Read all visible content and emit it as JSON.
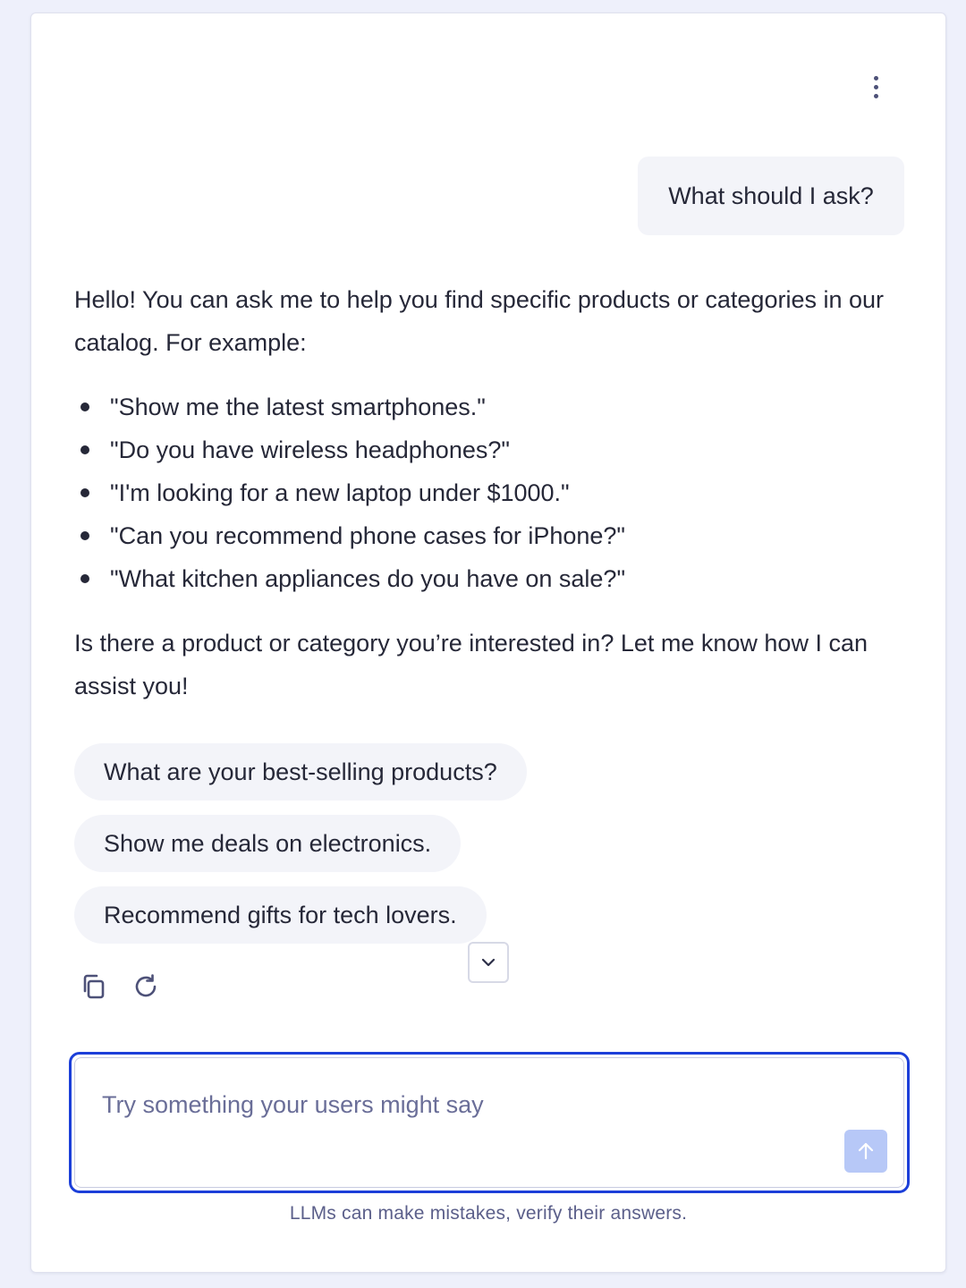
{
  "header": {
    "menu_icon": "more-vertical-icon"
  },
  "conversation": {
    "user_message": "What should I ask?",
    "assistant_intro": "Hello! You can ask me to help you find specific products or categories in our catalog. For example:",
    "assistant_examples": [
      "\"Show me the latest smartphones.\"",
      "\"Do you have wireless headphones?\"",
      "\"I'm looking for a new laptop under $1000.\"",
      "\"Can you recommend phone cases for iPhone?\"",
      "\"What kitchen appliances do you have on sale?\""
    ],
    "assistant_outro": "Is there a product or category you’re interested in? Let me know how I can assist you!"
  },
  "suggestions": [
    "What are your best-selling products?",
    "Show me deals on electronics.",
    "Recommend gifts for tech lovers."
  ],
  "actions": {
    "copy_icon": "copy-icon",
    "regenerate_icon": "refresh-icon",
    "scroll_icon": "chevron-down-icon"
  },
  "composer": {
    "value": "",
    "placeholder": "Try something your users might say",
    "send_icon": "arrow-up-icon"
  },
  "footer": {
    "disclaimer": "LLMs can make mistakes, verify their answers."
  },
  "colors": {
    "page_background": "#eef0fb",
    "accent": "#1c3fd9",
    "send_button_disabled": "#b7c8f7",
    "bubble_background": "#f3f4f9"
  }
}
